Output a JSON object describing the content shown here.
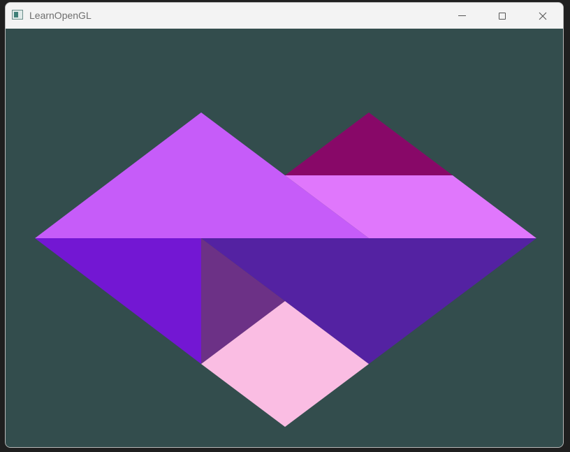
{
  "window": {
    "title": "LearnOpenGL"
  },
  "titlebar": {
    "icons": {
      "app": "app-window-icon",
      "minimize": "minimize-icon",
      "maximize": "maximize-icon",
      "close": "close-icon"
    }
  },
  "scene": {
    "background_color": "#334d4d",
    "shapes": [
      {
        "name": "large-triangle-top-left",
        "color": "#c65cf9"
      },
      {
        "name": "small-triangle-top-right",
        "color": "#880868"
      },
      {
        "name": "parallelogram-right",
        "color": "#e077fc"
      },
      {
        "name": "large-triangle-bottom-left",
        "color": "#7317d3"
      },
      {
        "name": "large-triangle-bottom-right",
        "color": "#5422a2"
      },
      {
        "name": "small-triangle-middle",
        "color": "#6c3186"
      },
      {
        "name": "square-bottom",
        "color": "#fabde3"
      }
    ]
  }
}
